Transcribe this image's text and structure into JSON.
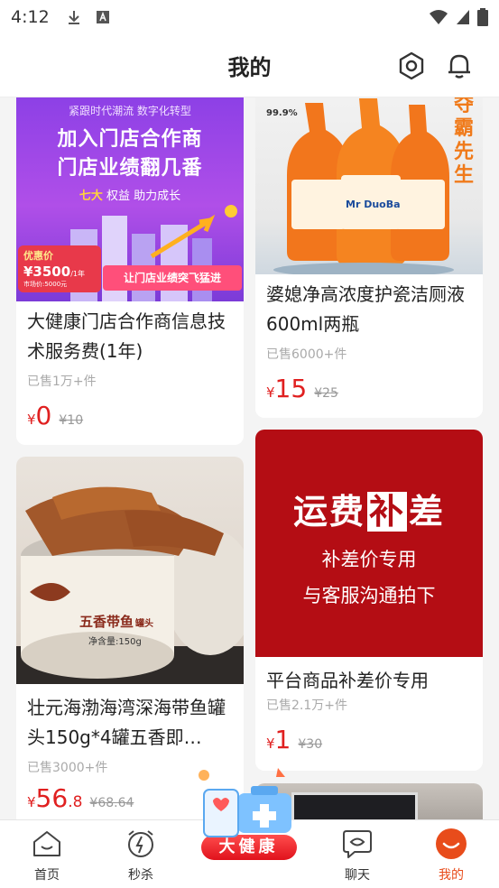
{
  "status_bar": {
    "time": "4:12"
  },
  "header": {
    "title": "我的"
  },
  "products": [
    {
      "name": "大健康门店合作商信息技术服务费(1年)",
      "sold": "已售1万+件",
      "price_int": "0",
      "price_dec": "",
      "original_price": "¥10",
      "banner": {
        "top_text": "紧跟时代潮流  数字化转型",
        "title_line1": "加入门店合作商",
        "title_line2": "门店业绩翻几番",
        "sub_text_accent": "七大",
        "sub_text": "权益 助力成长",
        "badge_label": "优惠价",
        "badge_price": "¥3500",
        "badge_unit": "/1年",
        "badge_market": "市场价:5000元",
        "slogan": "让门店业绩突飞猛进"
      }
    },
    {
      "name": "婆媳净高浓度护瓷洁厕液600ml两瓶",
      "sold": "已售6000+件",
      "price_int": "15",
      "price_dec": "",
      "original_price": "¥25",
      "banner": {
        "brand": "Mr DuoBa",
        "side_text": "夺霸先生",
        "badge": "99.9%"
      }
    },
    {
      "name": "壮元海渤海湾深海带鱼罐头150g*4罐五香即…",
      "sold": "已售3000+件",
      "price_int": "56",
      "price_dec": ".8",
      "original_price": "¥68.64",
      "banner": {
        "can_label": "五香带鱼",
        "can_sub": "罐头",
        "can_weight": "净含量:150g"
      }
    },
    {
      "name": "平台商品补差价专用",
      "sold": "已售2.1万+件",
      "price_int": "1",
      "price_dec": "",
      "original_price": "¥30",
      "banner": {
        "title_a": "运费",
        "title_b": "补",
        "title_c": "差",
        "line1": "补差价专用",
        "line2": "与客服沟通拍下"
      }
    }
  ],
  "tabbar": {
    "tabs": [
      {
        "label": "首页"
      },
      {
        "label": "秒杀"
      },
      {
        "label": "大健康"
      },
      {
        "label": "聊天"
      },
      {
        "label": "我的"
      }
    ],
    "active_color": "#e84c1b"
  },
  "colors": {
    "price": "#e02020",
    "accent": "#e84c1b"
  }
}
